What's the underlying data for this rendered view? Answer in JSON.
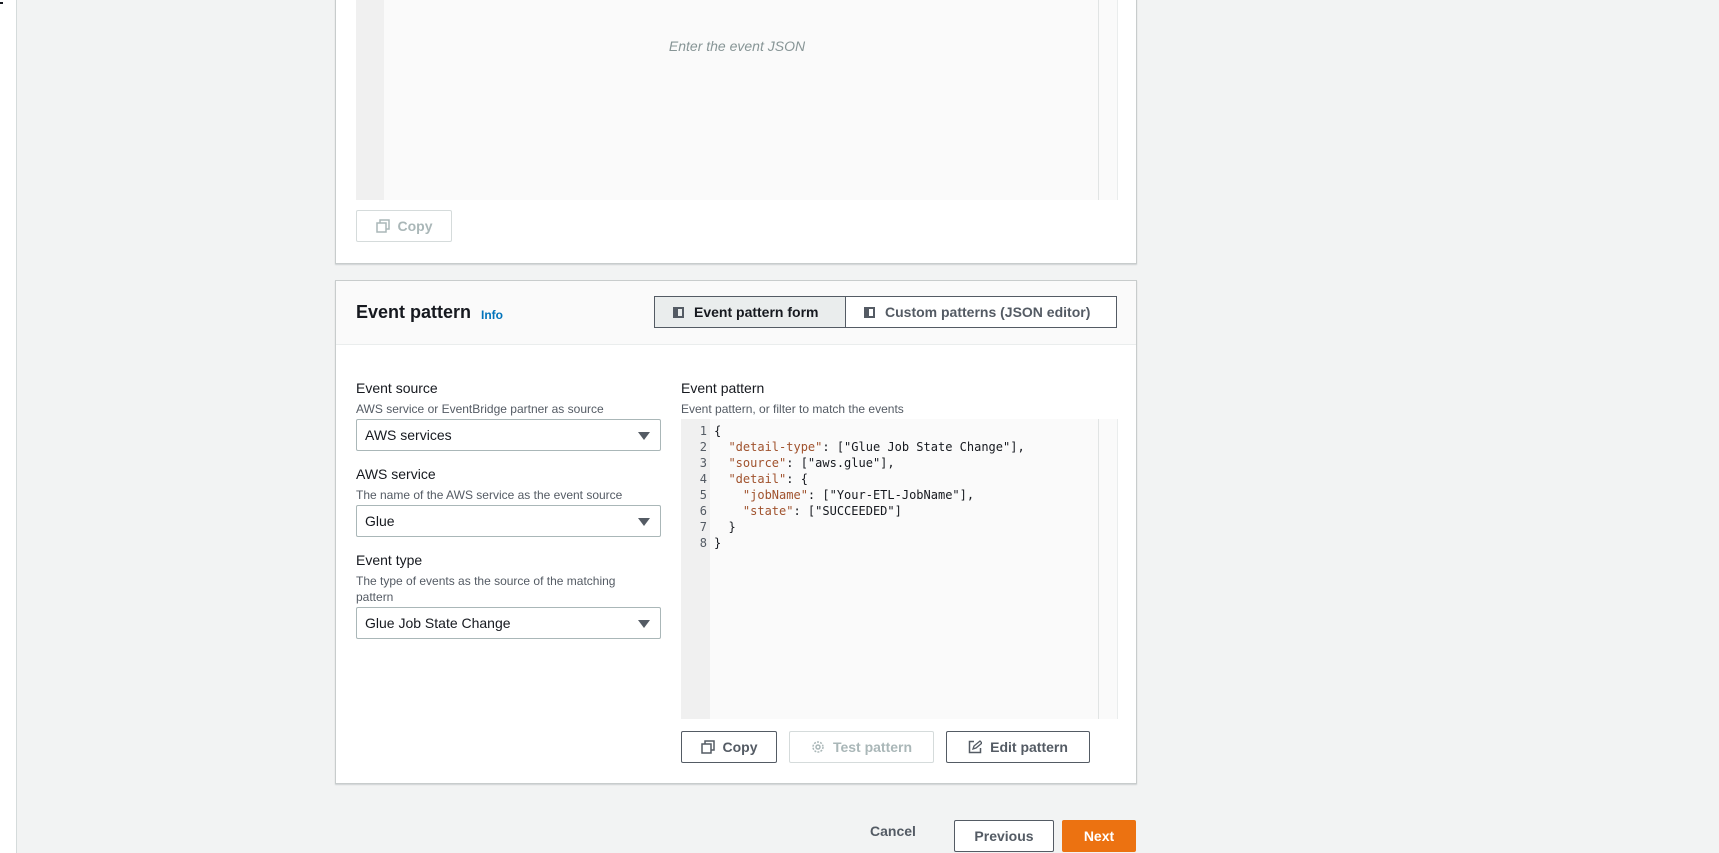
{
  "top_panel": {
    "editor_placeholder": "Enter the event JSON",
    "copy_label": "Copy"
  },
  "event_pattern_panel": {
    "title": "Event pattern",
    "info": "Info",
    "tabs": [
      {
        "label": "Event pattern form",
        "active": true
      },
      {
        "label": "Custom patterns (JSON editor)",
        "active": false
      }
    ],
    "event_source": {
      "label": "Event source",
      "description": "AWS service or EventBridge partner as source",
      "value": "AWS services"
    },
    "aws_service": {
      "label": "AWS service",
      "description": "The name of the AWS service as the event source",
      "value": "Glue"
    },
    "event_type": {
      "label": "Event type",
      "description": "The type of events as the source of the matching pattern",
      "value": "Glue Job State Change"
    },
    "pattern": {
      "label": "Event pattern",
      "description": "Event pattern, or filter to match the events",
      "lines": [
        {
          "num": "1",
          "key": "",
          "rest": "{"
        },
        {
          "num": "2",
          "key": "  \"detail-type\"",
          "rest": ": [\"Glue Job State Change\"],"
        },
        {
          "num": "3",
          "key": "  \"source\"",
          "rest": ": [\"aws.glue\"],"
        },
        {
          "num": "4",
          "key": "  \"detail\"",
          "rest": ": {"
        },
        {
          "num": "5",
          "key": "    \"jobName\"",
          "rest": ": [\"Your-ETL-JobName\"],"
        },
        {
          "num": "6",
          "key": "    \"state\"",
          "rest": ": [\"SUCCEEDED\"]"
        },
        {
          "num": "7",
          "key": "",
          "rest": "  }"
        },
        {
          "num": "8",
          "key": "",
          "rest": "}"
        }
      ]
    },
    "copy_label": "Copy",
    "test_label": "Test pattern",
    "edit_label": "Edit pattern"
  },
  "footer": {
    "cancel_label": "Cancel",
    "previous_label": "Previous",
    "next_label": "Next"
  },
  "colors": {
    "primary": "#ec7211",
    "link": "#0073bb"
  }
}
